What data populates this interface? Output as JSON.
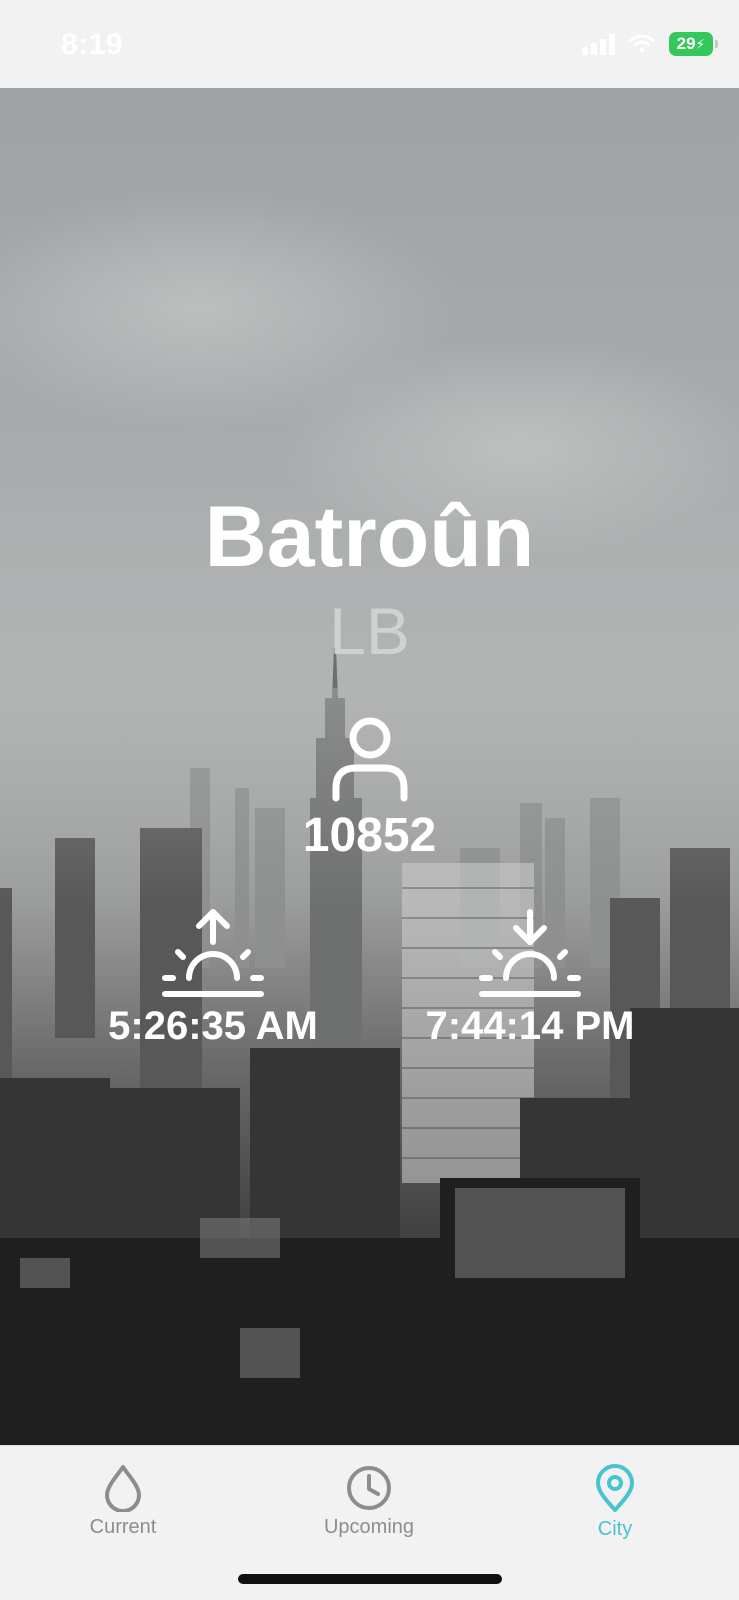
{
  "status_bar": {
    "time": "8:19",
    "battery": "29"
  },
  "city": {
    "name": "Batroûn",
    "country": "LB",
    "population": "10852",
    "sunrise": "5:26:35 AM",
    "sunset": "7:44:14 PM"
  },
  "icons": {
    "population": "person-icon",
    "sunrise": "sunrise-icon",
    "sunset": "sunset-icon"
  },
  "tabs": [
    {
      "label": "Current",
      "icon": "drop-icon",
      "active": false
    },
    {
      "label": "Upcoming",
      "icon": "clock-icon",
      "active": false
    },
    {
      "label": "City",
      "icon": "location-pin-icon",
      "active": true
    }
  ],
  "colors": {
    "accent": "#47c4d0",
    "tab_inactive": "#8d8d8d",
    "battery": "#34c759"
  }
}
